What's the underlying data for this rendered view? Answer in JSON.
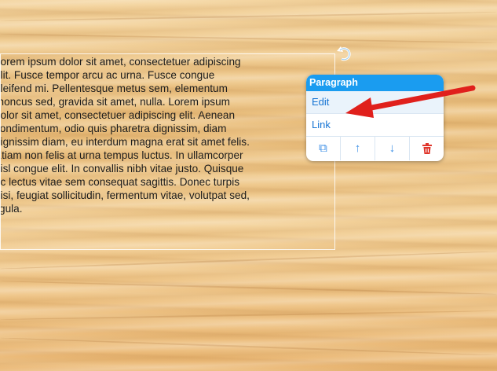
{
  "text_block": {
    "lines": [
      "Lorem ipsum dolor sit amet, consectetuer adipiscing",
      "elit. Fusce tempor arcu ac urna. Fusce congue",
      "eleifend mi. Pellentesque metus sem, elementum",
      "rhoncus sed, gravida sit amet, nulla. Lorem ipsum",
      "dolor sit amet, consectetuer adipiscing elit. Aenean",
      "condimentum, odio quis pharetra dignissim, diam",
      "dignissim diam, eu interdum magna erat sit amet felis.",
      "Etiam non felis at urna tempus luctus. In ullamcorper",
      "nisl congue elit. In convallis nibh vitae justo. Quisque",
      "ac lectus vitae sem consequat sagittis. Donec turpis",
      "nisi, feugiat sollicitudin, fermentum vitae, volutpat sed,",
      "ligula."
    ]
  },
  "context_menu": {
    "title": "Paragraph",
    "items": [
      "Edit",
      "Link"
    ],
    "tools": [
      {
        "icon": "duplicate-icon",
        "glyph": "⧉"
      },
      {
        "icon": "move-up-icon",
        "glyph": "↑"
      },
      {
        "icon": "move-down-icon",
        "glyph": "↓"
      },
      {
        "icon": "delete-icon",
        "glyph": "🗑"
      }
    ]
  },
  "colors": {
    "menu_header": "#1a9cf0",
    "menu_link": "#1574d4",
    "delete": "#e0362c",
    "annotation_arrow": "#e0201c"
  }
}
